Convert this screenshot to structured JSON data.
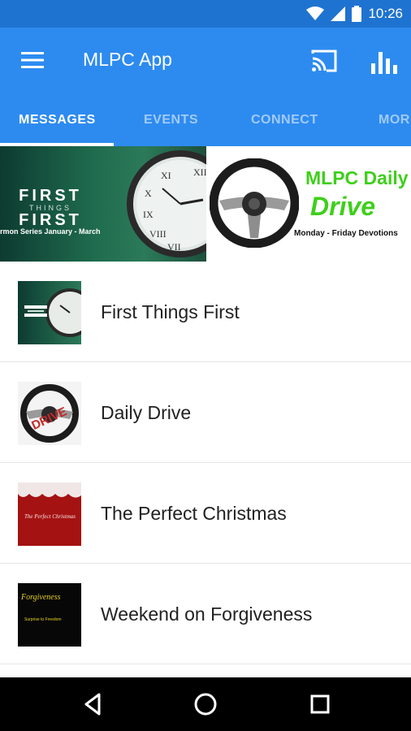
{
  "status_bar": {
    "time": "10:26"
  },
  "app_bar": {
    "title": "MLPC App"
  },
  "tabs": [
    {
      "label": "MESSAGES"
    },
    {
      "label": "EVENTS"
    },
    {
      "label": "CONNECT"
    },
    {
      "label": "MOR"
    }
  ],
  "banners": {
    "left": {
      "line1": "FIRST",
      "line2": "THINGS",
      "line3": "FIRST",
      "caption": "rmon Series January - March"
    },
    "right": {
      "title_line1": "MLPC Daily",
      "title_line2": "Drive",
      "caption": "Monday - Friday Devotions"
    }
  },
  "thumb_texts": {
    "drive_stamp": "DRIVE",
    "christmas_script": "The Perfect Christmas",
    "forgiveness_script": "Forgiveness",
    "forgiveness_line": "Surprise to Freedom"
  },
  "messages": [
    {
      "title": "First Things First"
    },
    {
      "title": "Daily Drive"
    },
    {
      "title": "The Perfect Christmas"
    },
    {
      "title": "Weekend on Forgiveness"
    }
  ],
  "colors": {
    "status_bar": "#1f73d0",
    "app_bar": "#2d8bf0",
    "drive_green": "#3fcf1c"
  }
}
